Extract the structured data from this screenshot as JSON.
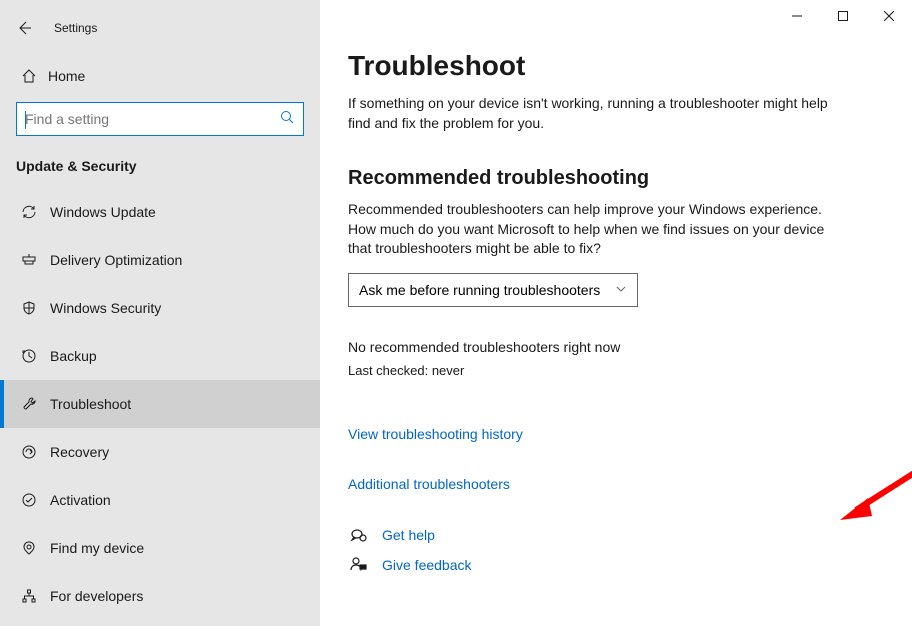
{
  "titlebar": {
    "title": "Settings"
  },
  "home": {
    "label": "Home"
  },
  "search": {
    "placeholder": "Find a setting"
  },
  "category": "Update & Security",
  "sidebar": {
    "items": [
      {
        "label": "Windows Update",
        "icon": "sync-icon"
      },
      {
        "label": "Delivery Optimization",
        "icon": "delivery-icon"
      },
      {
        "label": "Windows Security",
        "icon": "shield-icon"
      },
      {
        "label": "Backup",
        "icon": "backup-icon"
      },
      {
        "label": "Troubleshoot",
        "icon": "wrench-icon"
      },
      {
        "label": "Recovery",
        "icon": "recovery-icon"
      },
      {
        "label": "Activation",
        "icon": "activation-icon"
      },
      {
        "label": "Find my device",
        "icon": "location-icon"
      },
      {
        "label": "For developers",
        "icon": "developer-icon"
      }
    ]
  },
  "page": {
    "title": "Troubleshoot",
    "description": "If something on your device isn't working, running a troubleshooter might help find and fix the problem for you.",
    "section_title": "Recommended troubleshooting",
    "section_description": "Recommended troubleshooters can help improve your Windows experience. How much do you want Microsoft to help when we find issues on your device that troubleshooters might be able to fix?",
    "dropdown_value": "Ask me before running troubleshooters",
    "status": "No recommended troubleshooters right now",
    "last_checked": "Last checked: never",
    "link_history": "View troubleshooting history",
    "link_additional": "Additional troubleshooters",
    "footer": {
      "help": "Get help",
      "feedback": "Give feedback"
    }
  }
}
